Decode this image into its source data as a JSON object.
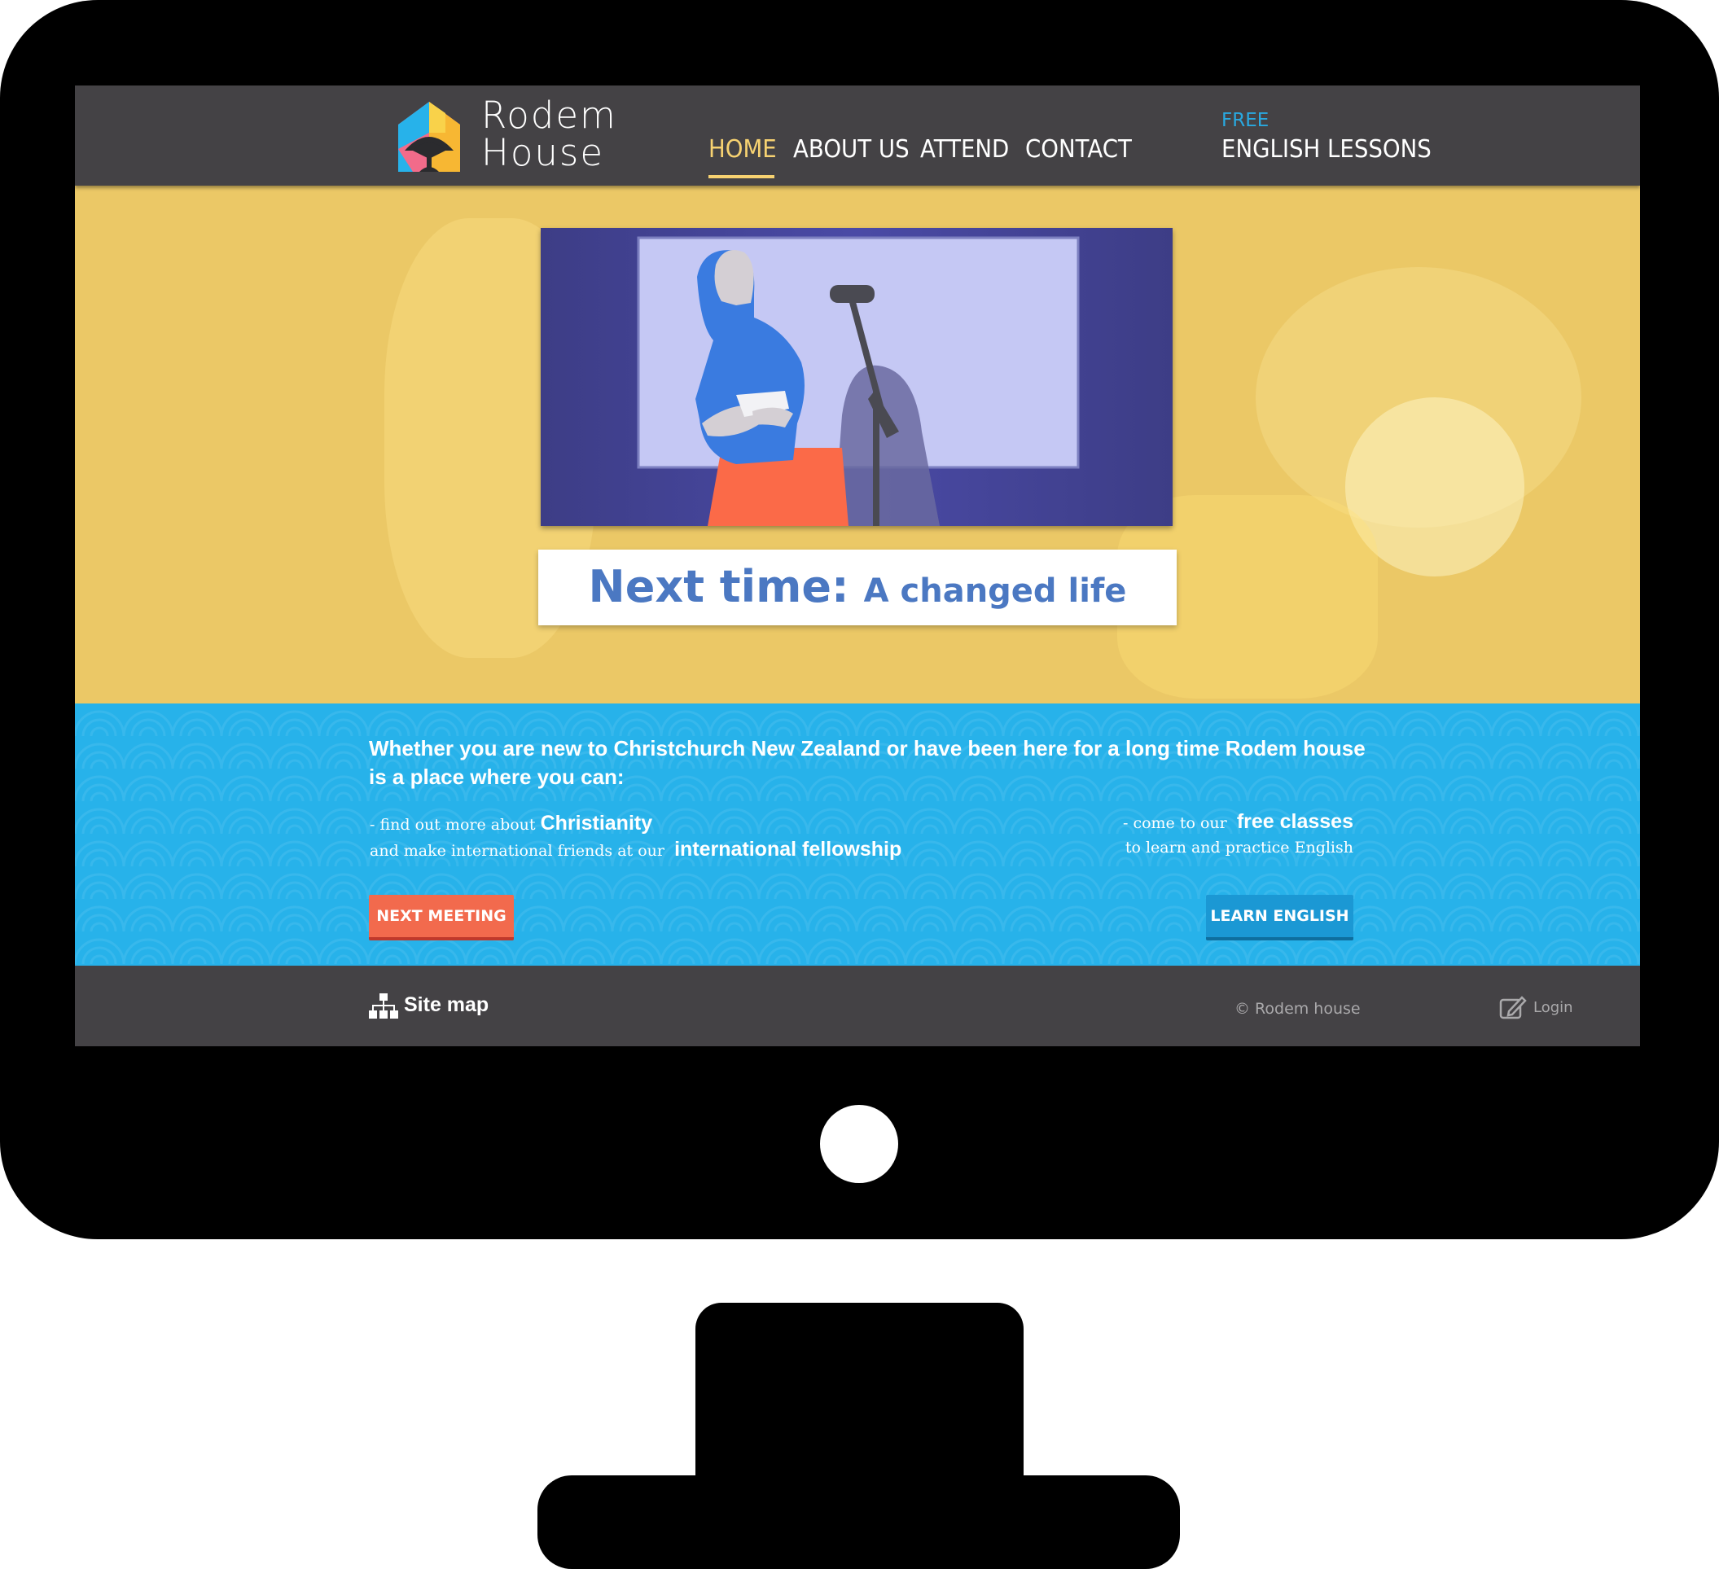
{
  "header": {
    "logo_line1": "Rodem",
    "logo_line2": "House",
    "logo_icon": "house-fan-logo-icon",
    "nav": {
      "home": "HOME",
      "about": "ABOUT US",
      "attend": "ATTEND",
      "contact": "CONTACT",
      "english_tag": "FREE",
      "english": "ENGLISH LESSONS"
    }
  },
  "hero": {
    "image": "woman-speaking-at-microphone-illustration",
    "banner_label": "Next time:",
    "banner_title": "A changed life"
  },
  "intro": {
    "text": "Whether you are new to Christchurch New Zealand or have been here for a long time Rodem house is a place where you can:",
    "left": {
      "prefix": "- find out more about",
      "highlight1": "Christianity",
      "line2": "and make international friends at our",
      "highlight2": "international fellowship"
    },
    "right": {
      "prefix": "- come to our",
      "highlight": "free classes",
      "line2": "to learn and practice English"
    },
    "buttons": {
      "next_meeting": "NEXT MEETING",
      "learn_english": "LEARN ENGLISH"
    }
  },
  "footer": {
    "sitemap_icon": "sitemap-icon",
    "sitemap": "Site map",
    "copyright": "© Rodem house",
    "login_icon": "edit-icon",
    "login": "Login"
  },
  "colors": {
    "header_bg": "#444245",
    "nav_active": "#f7d271",
    "free_tag": "#29a9e1",
    "hero_bg": "#ebc866",
    "band_bg": "#27b2ea",
    "banner_text": "#4b78c2",
    "next_button": "#f26a4d",
    "learn_button": "#1b98d4"
  }
}
